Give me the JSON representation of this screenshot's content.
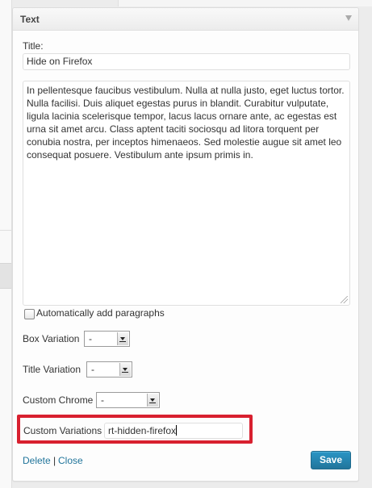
{
  "widget": {
    "title": "Text",
    "title_label": "Title:",
    "title_value": "Hide on Firefox",
    "content_text": "In pellentesque faucibus vestibulum. Nulla at nulla justo, eget luctus tortor. Nulla facilisi. Duis aliquet egestas purus in blandit. Curabitur vulputate, ligula lacinia scelerisque tempor, lacus lacus ornare ante, ac egestas est urna sit amet arcu. Class aptent taciti sociosqu ad litora torquent per conubia nostra, per inceptos himenaeos. Sed molestie augue sit amet leo consequat posuere. Vestibulum ante ipsum primis in.",
    "auto_paragraphs_label": "Automatically add paragraphs",
    "auto_paragraphs_checked": false,
    "box_variation": {
      "label": "Box Variation",
      "value": "-"
    },
    "title_variation": {
      "label": "Title Variation",
      "value": "-"
    },
    "custom_chrome": {
      "label": "Custom Chrome",
      "value": "-"
    },
    "custom_variations": {
      "label": "Custom Variations",
      "value": "rt-hidden-firefox"
    },
    "delete_label": "Delete",
    "separator": "|",
    "close_label": "Close",
    "save_label": "Save"
  },
  "colors": {
    "highlight": "#d8202f",
    "link": "#21759b",
    "save_button": "#2a95c5"
  },
  "icons": {
    "header_toggle": "triangle-down-icon",
    "select_arrow": "chevron-down-icon",
    "resize_grip": "resize-grip-icon"
  }
}
